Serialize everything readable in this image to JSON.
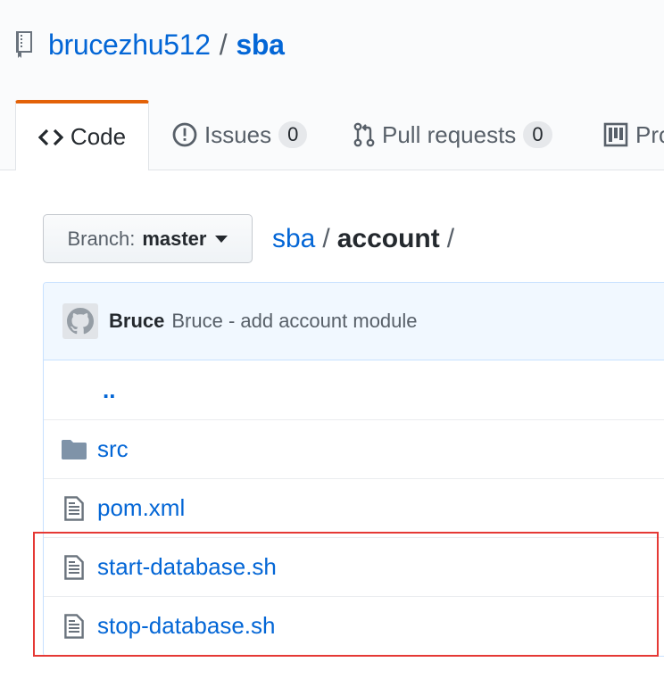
{
  "repo": {
    "owner": "brucezhu512",
    "separator": "/",
    "name": "sba"
  },
  "tabs": [
    {
      "label": "Code",
      "icon": "code-icon",
      "selected": true
    },
    {
      "label": "Issues",
      "icon": "issue-opened-icon",
      "count": "0"
    },
    {
      "label": "Pull requests",
      "icon": "git-pull-request-icon",
      "count": "0"
    },
    {
      "label": "Pro",
      "icon": "project-icon"
    }
  ],
  "branch": {
    "label": "Branch:",
    "value": "master"
  },
  "breadcrumb": {
    "root": "sba",
    "separator": "/",
    "current": "account",
    "trailing": "/"
  },
  "commit": {
    "author": "Bruce",
    "message": "Bruce - add account module"
  },
  "files": [
    {
      "name": "..",
      "type": "parent"
    },
    {
      "name": "src",
      "type": "directory",
      "icon": "folder-icon"
    },
    {
      "name": "pom.xml",
      "type": "file",
      "icon": "file-icon"
    },
    {
      "name": "start-database.sh",
      "type": "file",
      "icon": "file-icon"
    },
    {
      "name": "stop-database.sh",
      "type": "file",
      "icon": "file-icon"
    }
  ],
  "colors": {
    "link": "#0366d6",
    "tab_accent": "#e36209",
    "highlight": "#e53935"
  }
}
